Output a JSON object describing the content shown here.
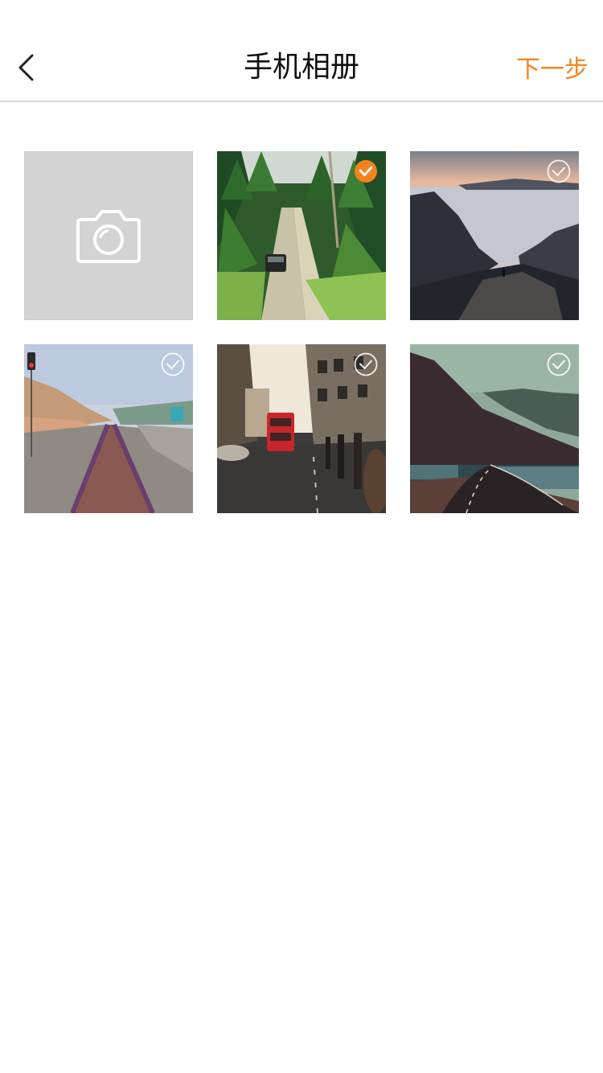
{
  "header": {
    "title": "手机相册",
    "next_label": "下一步",
    "back_icon": "chevron-left-icon"
  },
  "colors": {
    "accent": "#f58220",
    "camera_tile_bg": "#d4d3d4",
    "divider": "#d9d9d9"
  },
  "gallery": {
    "camera_tile": {
      "icon": "camera-icon"
    },
    "photos": [
      {
        "subject": "forest-road-with-car",
        "selected": true
      },
      {
        "subject": "mountain-cliffs-over-sea",
        "selected": false
      },
      {
        "subject": "railway-tracks-by-coast",
        "selected": false
      },
      {
        "subject": "city-street-with-red-bus",
        "selected": false
      },
      {
        "subject": "winding-road-in-valley",
        "selected": false
      }
    ]
  }
}
